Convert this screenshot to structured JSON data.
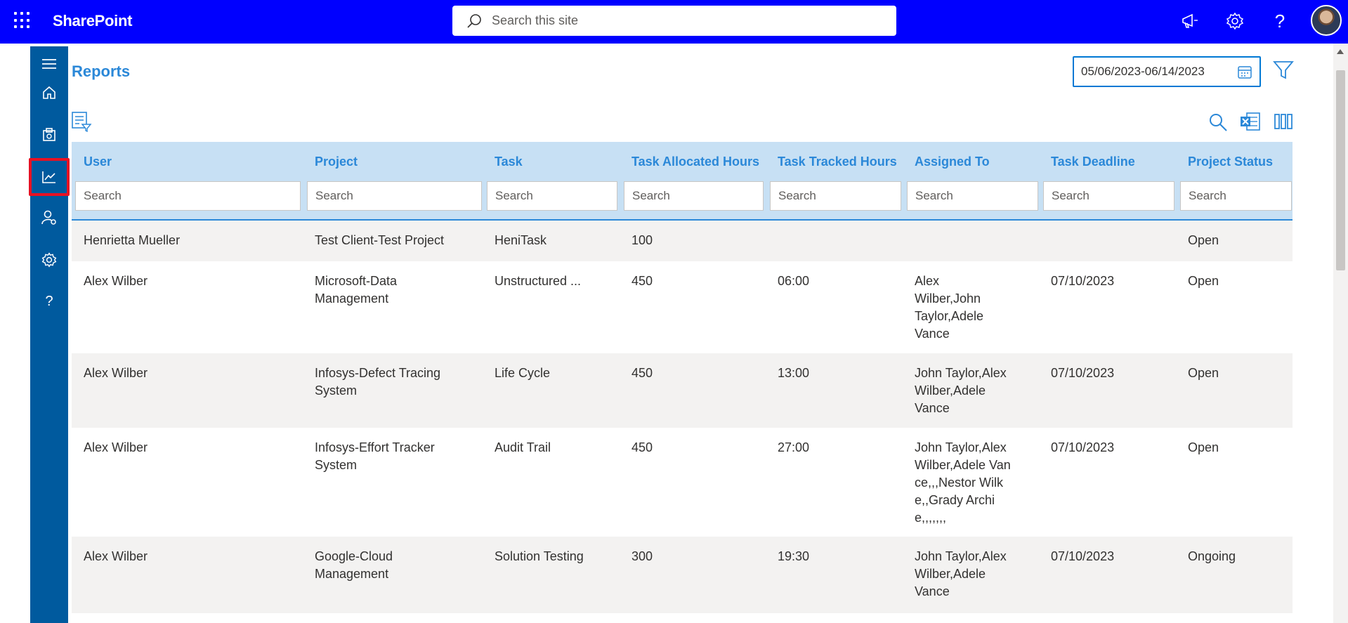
{
  "app": {
    "brand": "SharePoint"
  },
  "search": {
    "placeholder": "Search this site"
  },
  "page": {
    "title": "Reports"
  },
  "date_range": {
    "value": "05/06/2023-06/14/2023"
  },
  "table": {
    "columns": [
      {
        "key": "user",
        "label": "User",
        "filter_placeholder": "Search"
      },
      {
        "key": "project",
        "label": "Project",
        "filter_placeholder": "Search"
      },
      {
        "key": "task",
        "label": "Task",
        "filter_placeholder": "Search"
      },
      {
        "key": "allocated",
        "label": "Task Allocated Hours",
        "filter_placeholder": "Search"
      },
      {
        "key": "tracked",
        "label": "Task Tracked Hours",
        "filter_placeholder": "Search"
      },
      {
        "key": "assigned",
        "label": "Assigned To",
        "filter_placeholder": "Search"
      },
      {
        "key": "deadline",
        "label": "Task Deadline",
        "filter_placeholder": "Search"
      },
      {
        "key": "status",
        "label": "Project Status",
        "filter_placeholder": "Search"
      }
    ],
    "rows": [
      {
        "user": "Henrietta Mueller",
        "project": "Test Client-Test Project",
        "task": "HeniTask",
        "allocated": "100",
        "tracked": "",
        "assigned": "",
        "deadline": "",
        "status": "Open"
      },
      {
        "user": "Alex Wilber",
        "project": "Microsoft-Data Management",
        "task": "Unstructured ...",
        "allocated": "450",
        "tracked": "06:00",
        "assigned": "Alex Wilber,John Taylor,Adele Vance",
        "deadline": "07/10/2023",
        "status": "Open"
      },
      {
        "user": "Alex Wilber",
        "project": "Infosys-Defect Tracing System",
        "task": "Life Cycle",
        "allocated": "450",
        "tracked": "13:00",
        "assigned": "John Taylor,Alex Wilber,Adele Vance",
        "deadline": "07/10/2023",
        "status": "Open"
      },
      {
        "user": "Alex Wilber",
        "project": "Infosys-Effort Tracker System",
        "task": "Audit Trail",
        "allocated": "450",
        "tracked": "27:00",
        "assigned": "John Taylor,Alex Wilber,Adele Vance,,,Nestor Wilke,,Grady Archie,,,,,,,",
        "deadline": "07/10/2023",
        "status": "Open"
      },
      {
        "user": "Alex Wilber",
        "project": "Google-Cloud Management",
        "task": "Solution Testing",
        "allocated": "300",
        "tracked": "19:30",
        "assigned": "John Taylor,Alex Wilber,Adele Vance",
        "deadline": "07/10/2023",
        "status": "Ongoing"
      }
    ]
  },
  "icons": {
    "topbar": [
      "app-launcher-icon",
      "search-icon",
      "megaphone-icon",
      "settings-icon",
      "help-icon"
    ],
    "rail": [
      "menu-icon",
      "home-icon",
      "timesheet-icon",
      "reports-icon",
      "user-settings-icon",
      "settings-icon",
      "help-icon"
    ],
    "toolbar": [
      "list-filter-icon",
      "search-icon",
      "excel-export-icon",
      "column-chooser-icon",
      "calendar-icon",
      "filter-icon"
    ]
  },
  "colors": {
    "topbar": "#0000ff",
    "rail": "#005a9e",
    "accent": "#2b88d8",
    "header_bg": "#c7e0f4",
    "active_outline": "#e81123"
  }
}
